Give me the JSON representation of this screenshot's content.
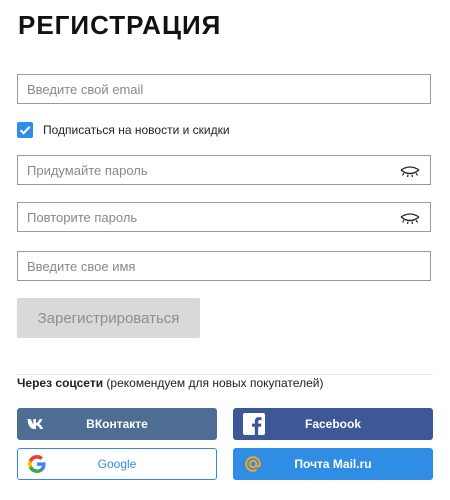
{
  "form": {
    "title": "РЕГИСТРАЦИЯ",
    "email_placeholder": "Введите свой email",
    "subscribe_label": "Подписаться на новости и скидки",
    "subscribe_checked": true,
    "password_placeholder": "Придумайте пароль",
    "password_repeat_placeholder": "Повторите пароль",
    "name_placeholder": "Введите свое имя",
    "submit_label": "Зарегистрироваться"
  },
  "social": {
    "caption_bold": "Через соцсети",
    "caption_rest": " (рекомендуем для новых покупателей)",
    "buttons": [
      {
        "label": "ВКонтакте",
        "icon": "vk-icon",
        "color": "#4d6d92"
      },
      {
        "label": "Facebook",
        "icon": "facebook-icon",
        "color": "#3c5897"
      },
      {
        "label": "Google",
        "icon": "google-icon",
        "color": "#2f8de4"
      },
      {
        "label": "Почта Mail.ru",
        "icon": "mailru-at-icon",
        "color": "#2f8de4"
      }
    ]
  },
  "colors": {
    "accent": "#2f8de4",
    "button_disabled": "#d9d9d9"
  }
}
